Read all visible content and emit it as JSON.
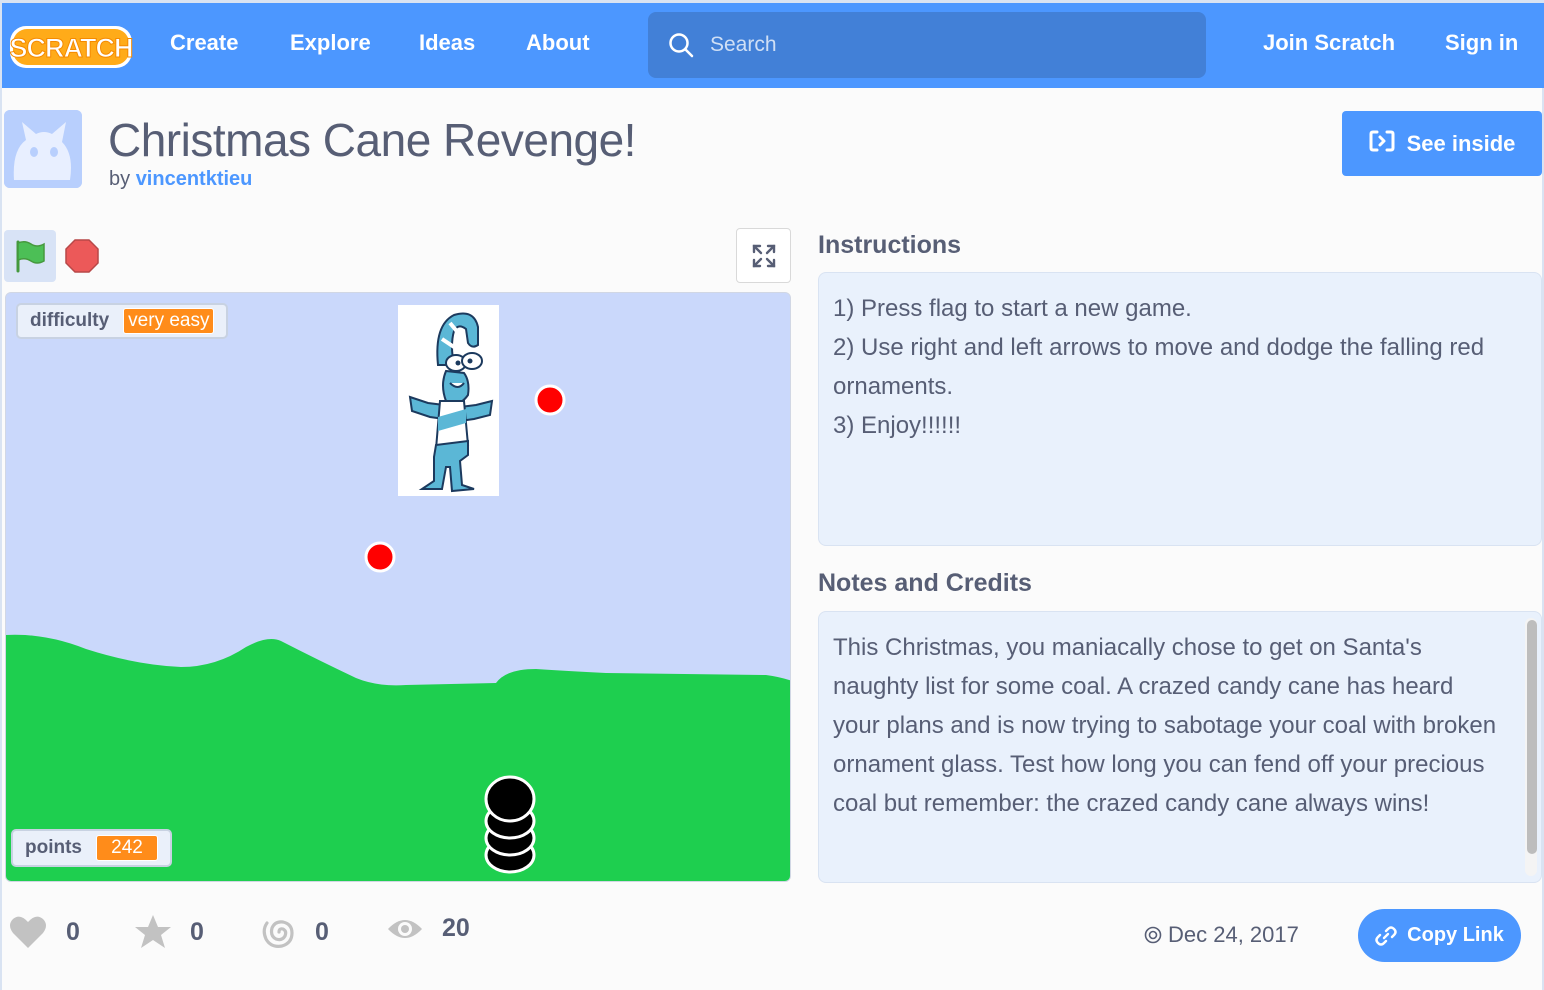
{
  "nav": {
    "logo_text": "SCRATCH",
    "links": {
      "create": "Create",
      "explore": "Explore",
      "ideas": "Ideas",
      "about": "About",
      "join": "Join Scratch",
      "signin": "Sign in"
    },
    "search": {
      "placeholder": "Search",
      "value": ""
    }
  },
  "project": {
    "title": "Christmas Cane Revenge!",
    "by_label": "by",
    "author": "vincentktieu",
    "see_inside_label": "See inside"
  },
  "player": {
    "monitors": {
      "difficulty": {
        "label": "difficulty",
        "value": "very easy"
      },
      "points": {
        "label": "points",
        "value": "242"
      }
    }
  },
  "instructions": {
    "heading": "Instructions",
    "lines": [
      "1) Press flag to start a new game.",
      "2) Use right and left arrows to move and dodge the falling red ornaments.",
      "3) Enjoy!!!!!!"
    ]
  },
  "notes": {
    "heading": "Notes and Credits",
    "text": "This Christmas, you maniacally chose to get on Santa's naughty list for some coal. A crazed candy cane has heard your plans and is now trying to sabotage your coal with broken ornament glass. Test how long you can fend off your precious coal but remember: the crazed candy cane always wins!"
  },
  "stats": {
    "loves": "0",
    "favorites": "0",
    "remixes": "0",
    "views": "20"
  },
  "date": "Dec 24, 2017",
  "copy_link_label": "Copy Link",
  "colors": {
    "brand_blue": "#4c97ff",
    "search_bg": "#4280d7",
    "monitor_orange": "#ff8c1a",
    "stage_sky": "#cad8fb",
    "stage_grass": "#1ecf4f",
    "ornament_red": "#ff0000"
  }
}
